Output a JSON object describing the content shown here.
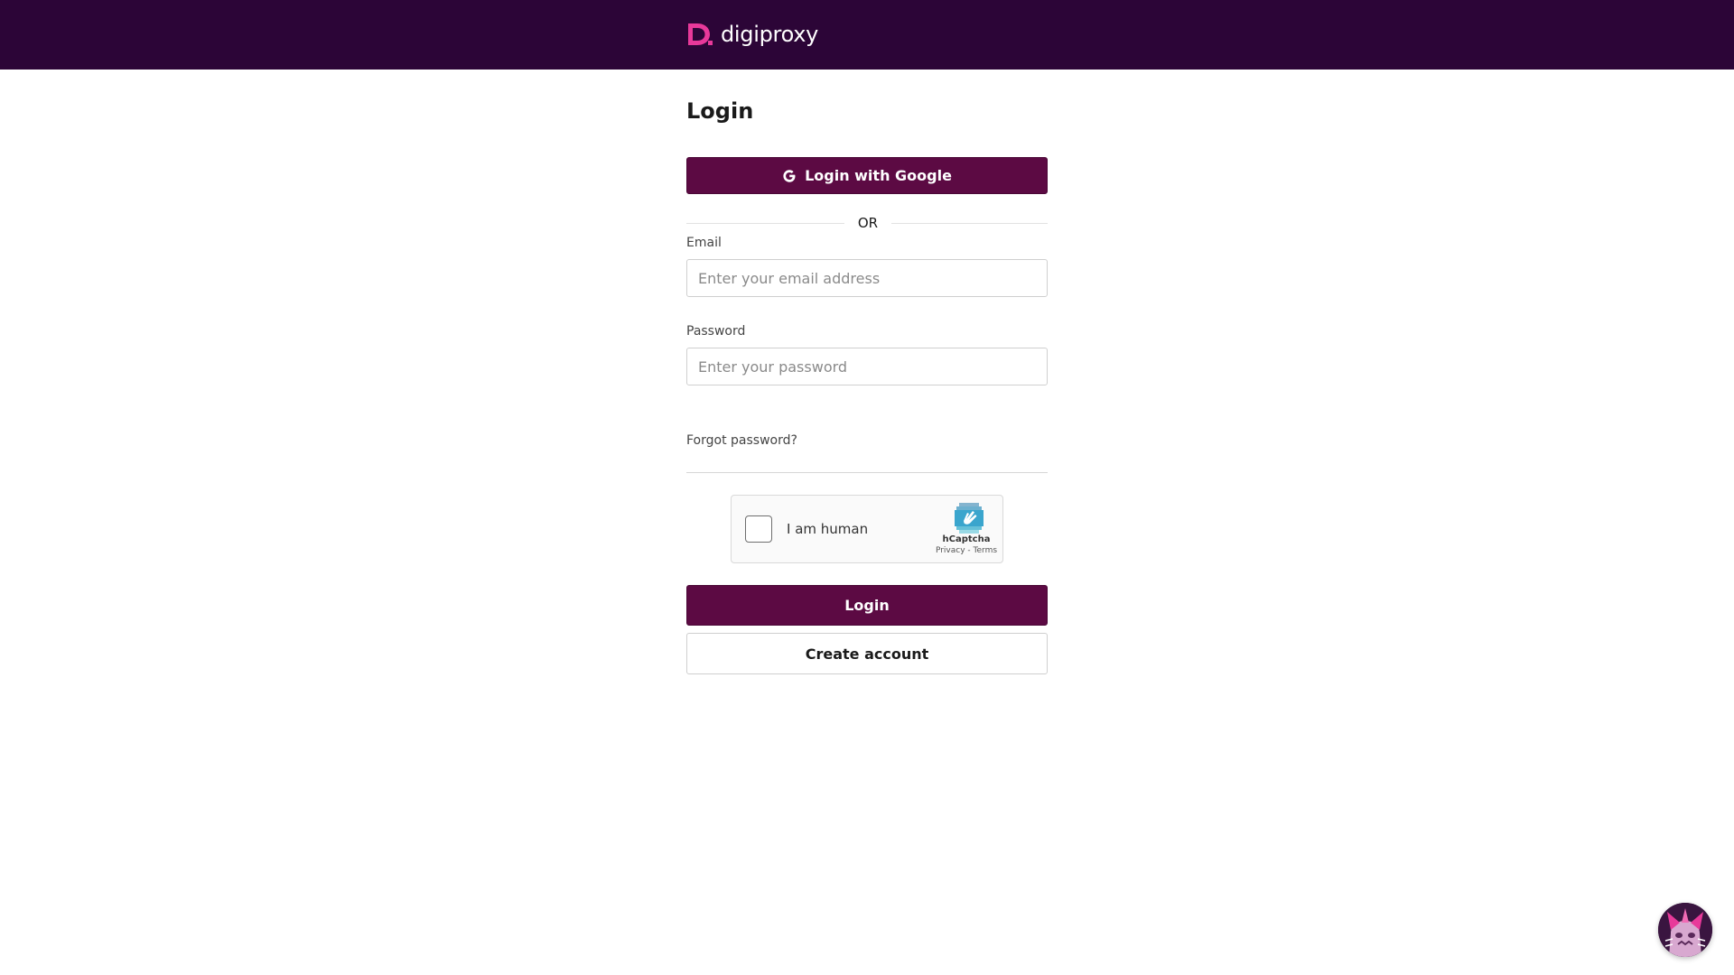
{
  "brand": {
    "name": "digiproxy",
    "logo_color": "#e8399a"
  },
  "colors": {
    "header_bg": "#2c0537",
    "primary": "#5c0a43"
  },
  "page": {
    "title": "Login"
  },
  "google_button": {
    "label": "Login with Google",
    "icon": "google-g-icon"
  },
  "divider": {
    "text": "OR"
  },
  "email": {
    "label": "Email",
    "placeholder": "Enter your email address",
    "value": ""
  },
  "password": {
    "label": "Password",
    "placeholder": "Enter your password",
    "value": ""
  },
  "forgot_link": "Forgot password?",
  "captcha": {
    "label": "I am human",
    "brand": "hCaptcha",
    "privacy": "Privacy",
    "separator": " - ",
    "terms": "Terms",
    "checked": false
  },
  "actions": {
    "login": "Login",
    "create_account": "Create account"
  },
  "chat_widget": {
    "icon": "chat-avatar-icon"
  }
}
